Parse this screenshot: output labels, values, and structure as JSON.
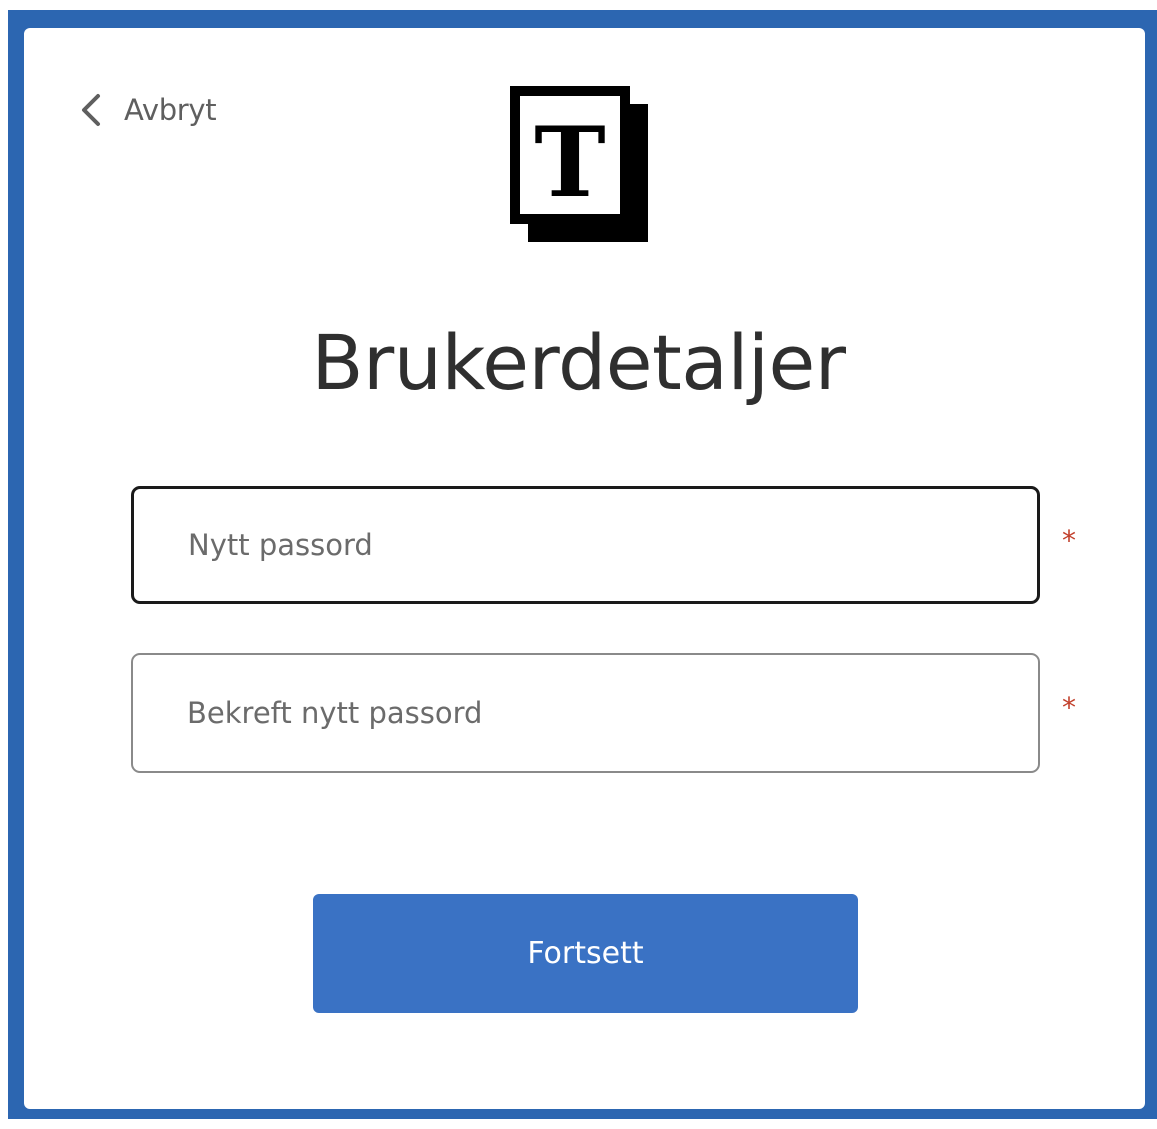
{
  "nav": {
    "back_label": "Avbryt",
    "back_icon": "chevron-left-icon"
  },
  "logo": {
    "letter": "T"
  },
  "page": {
    "title": "Brukerdetaljer"
  },
  "form": {
    "new_password": {
      "placeholder": "Nytt passord",
      "value": "",
      "required_marker": "*",
      "focused": true
    },
    "confirm_password": {
      "placeholder": "Bekreft nytt passord",
      "value": "",
      "required_marker": "*",
      "focused": false
    },
    "submit_label": "Fortsett"
  },
  "colors": {
    "frame": "#2c66b1",
    "primary_button": "#3a72c4",
    "required_marker": "#c2402c",
    "title_text": "#2f2f2f"
  }
}
